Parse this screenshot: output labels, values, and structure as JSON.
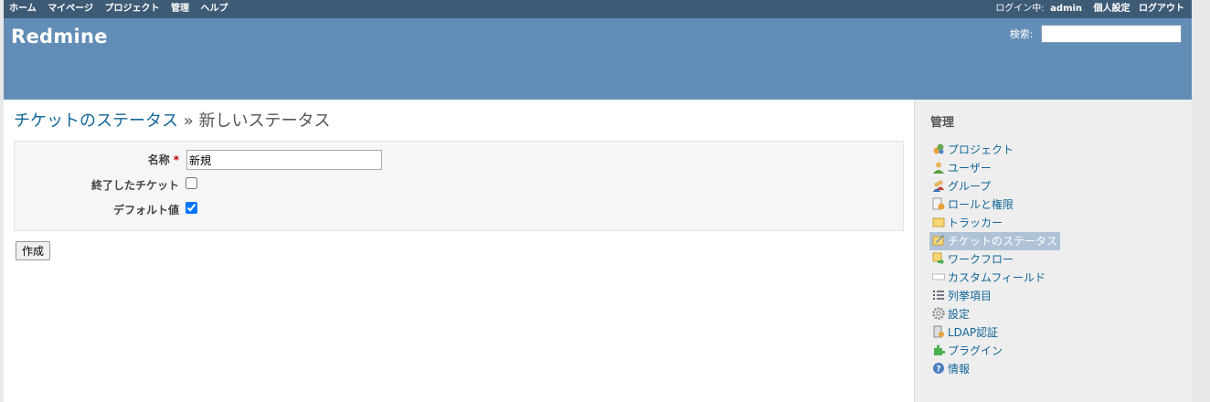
{
  "top_menu": {
    "items": [
      "ホーム",
      "マイページ",
      "プロジェクト",
      "管理",
      "ヘルプ"
    ],
    "login_prefix": "ログイン中:",
    "login_user": "admin",
    "my_account": "個人設定",
    "logout": "ログアウト"
  },
  "header": {
    "title": "Redmine",
    "search_label": "検索:",
    "search_value": ""
  },
  "page": {
    "breadcrumb_link": "チケットのステータス",
    "separator": " » ",
    "title": "新しいステータス"
  },
  "form": {
    "name_label": "名称",
    "required_mark": "*",
    "name_value": "新規",
    "closed_label": "終了したチケット",
    "closed_checked": false,
    "default_label": "デフォルト値",
    "default_checked": true,
    "submit_label": "作成"
  },
  "sidebar": {
    "title": "管理",
    "items": [
      {
        "label": "プロジェクト",
        "icon": "projects-icon",
        "selected": false
      },
      {
        "label": "ユーザー",
        "icon": "user-icon",
        "selected": false
      },
      {
        "label": "グループ",
        "icon": "group-icon",
        "selected": false
      },
      {
        "label": "ロールと権限",
        "icon": "roles-icon",
        "selected": false
      },
      {
        "label": "トラッカー",
        "icon": "tracker-icon",
        "selected": false
      },
      {
        "label": "チケットのステータス",
        "icon": "issue-status-icon",
        "selected": true
      },
      {
        "label": "ワークフロー",
        "icon": "workflow-icon",
        "selected": false
      },
      {
        "label": "カスタムフィールド",
        "icon": "custom-field-icon",
        "selected": false
      },
      {
        "label": "列挙項目",
        "icon": "list-icon",
        "selected": false
      },
      {
        "label": "設定",
        "icon": "gear-icon",
        "selected": false
      },
      {
        "label": "LDAP認証",
        "icon": "ldap-icon",
        "selected": false
      },
      {
        "label": "プラグイン",
        "icon": "plugin-icon",
        "selected": false
      },
      {
        "label": "情報",
        "icon": "help-icon",
        "selected": false
      }
    ]
  },
  "colors": {
    "top_bar": "#3e5b76",
    "header": "#628db6",
    "link": "#116699",
    "sidebar_bg": "#eeeeee",
    "selected_bg": "#b0c3d6"
  }
}
